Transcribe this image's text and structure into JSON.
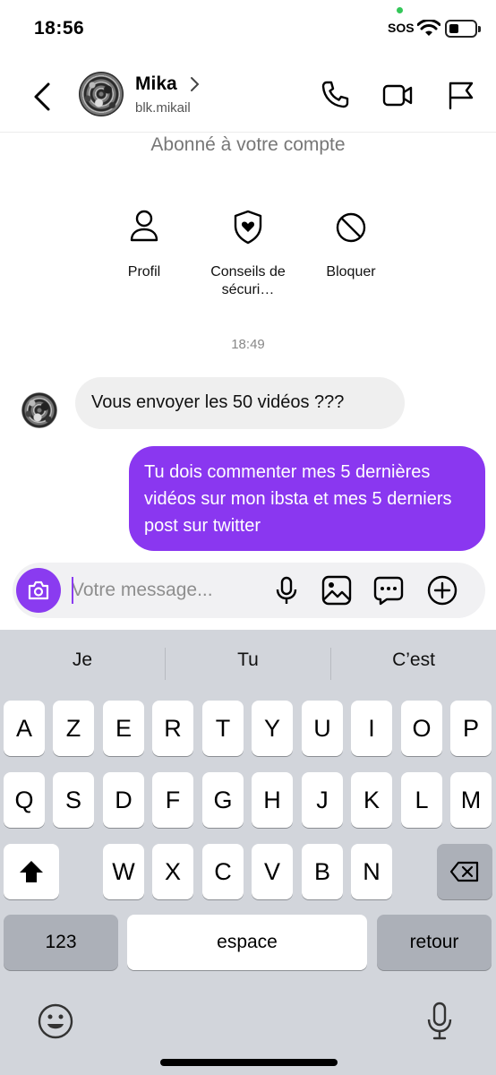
{
  "status_bar": {
    "time": "18:56",
    "sos": "SOS",
    "wifi_icon": "wifi-icon",
    "battery_icon": "battery-icon"
  },
  "header": {
    "contact_name": "Mika",
    "username": "blk.mikail",
    "back_icon": "chevron-left-icon",
    "call_icon": "phone-icon",
    "video_icon": "video-camera-icon",
    "report_icon": "flag-icon"
  },
  "profile_info": {
    "subscribed_text": "Abonné à votre compte"
  },
  "actions": [
    {
      "label": "Profil",
      "icon": "person-icon"
    },
    {
      "label": "Conseils de sécuri…",
      "icon": "shield-heart-icon"
    },
    {
      "label": "Bloquer",
      "icon": "block-icon"
    }
  ],
  "conversation": {
    "timestamp": "18:49",
    "messages": [
      {
        "direction": "incoming",
        "text": "Vous envoyer les 50 vidéos ???"
      },
      {
        "direction": "outgoing",
        "text": "Tu dois commenter mes 5 dernières vidéos sur mon ibsta et mes 5 derniers post sur twitter"
      }
    ]
  },
  "composer": {
    "placeholder": "Votre message...",
    "value": "",
    "camera_icon": "camera-icon",
    "mic_icon": "microphone-icon",
    "gallery_icon": "image-icon",
    "sticker_icon": "chat-bubble-icon",
    "plus_icon": "plus-circle-icon"
  },
  "keyboard": {
    "suggestions": [
      "Je",
      "Tu",
      "C’est"
    ],
    "row1": [
      "A",
      "Z",
      "E",
      "R",
      "T",
      "Y",
      "U",
      "I",
      "O",
      "P"
    ],
    "row2": [
      "Q",
      "S",
      "D",
      "F",
      "G",
      "H",
      "J",
      "K",
      "L",
      "M"
    ],
    "row3": [
      "W",
      "X",
      "C",
      "V",
      "B",
      "N"
    ],
    "numbers_key": "123",
    "space_key": "espace",
    "return_key": "retour",
    "shift_icon": "shift-icon",
    "delete_icon": "backspace-icon",
    "emoji_icon": "emoji-icon",
    "dictation_icon": "microphone-icon"
  },
  "colors": {
    "accent": "#8a37f0",
    "incoming_bubble": "#efefef",
    "keyboard_bg": "#d2d5db"
  }
}
